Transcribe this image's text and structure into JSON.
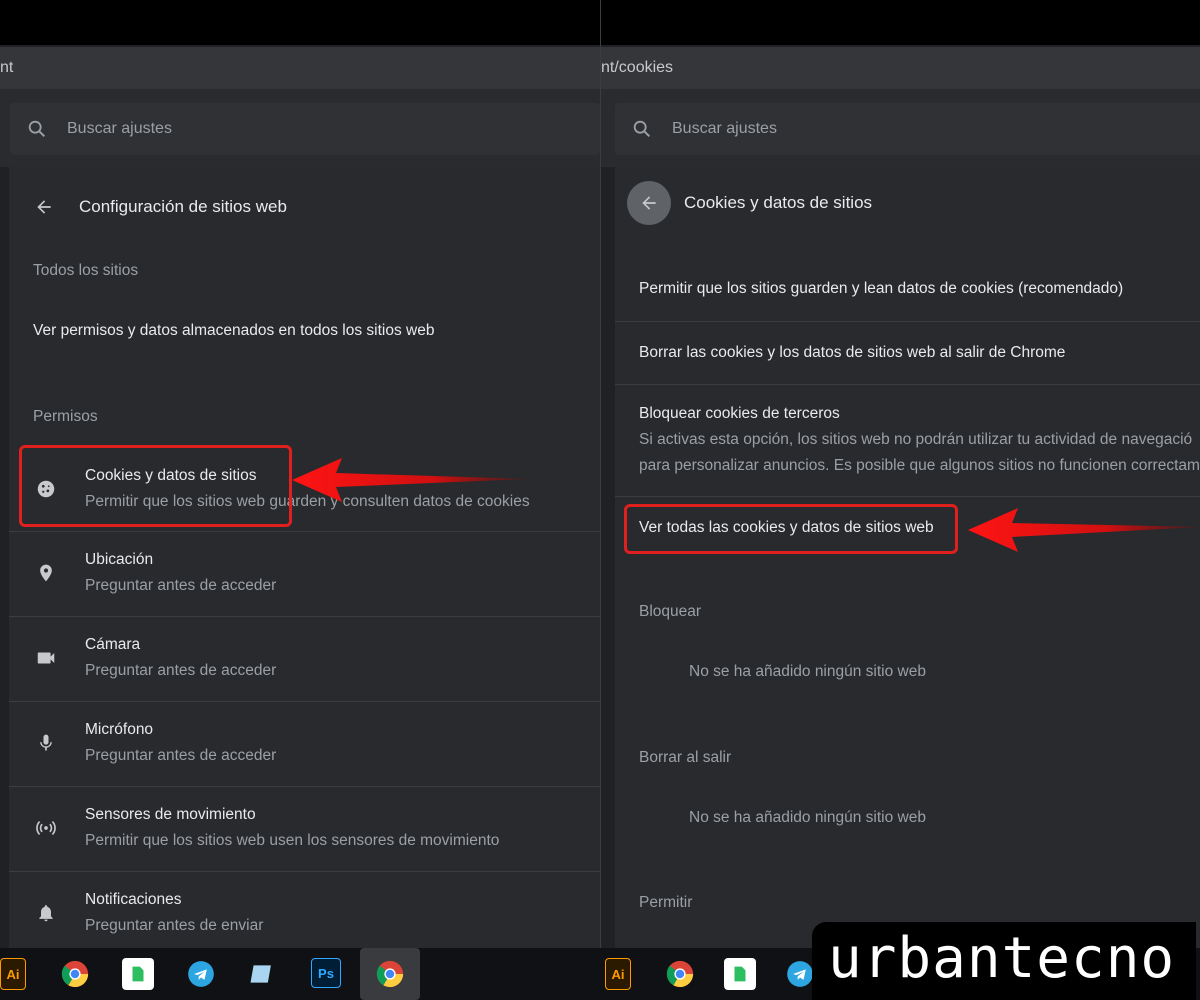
{
  "left": {
    "url": "nt",
    "search_placeholder": "Buscar ajustes",
    "header_title": "Configuración de sitios web",
    "all_sites": {
      "heading": "Todos los sitios",
      "link": "Ver permisos y datos almacenados en todos los sitios web"
    },
    "permissions_heading": "Permisos",
    "items": [
      {
        "title": "Cookies y datos de sitios",
        "subtitle": "Permitir que los sitios web guarden y consulten datos de cookies",
        "icon": "cookie-icon"
      },
      {
        "title": "Ubicación",
        "subtitle": "Preguntar antes de acceder",
        "icon": "location-pin-icon"
      },
      {
        "title": "Cámara",
        "subtitle": "Preguntar antes de acceder",
        "icon": "camera-icon"
      },
      {
        "title": "Micrófono",
        "subtitle": "Preguntar antes de acceder",
        "icon": "microphone-icon"
      },
      {
        "title": "Sensores de movimiento",
        "subtitle": "Permitir que los sitios web usen los sensores de movimiento",
        "icon": "motion-sensor-icon"
      },
      {
        "title": "Notificaciones",
        "subtitle": "Preguntar antes de enviar",
        "icon": "bell-icon"
      }
    ]
  },
  "right": {
    "url": "nt/cookies",
    "search_placeholder": "Buscar ajustes",
    "header_title": "Cookies y datos de sitios",
    "options": [
      {
        "label": "Permitir que los sitios guarden y lean datos de cookies (recomendado)"
      },
      {
        "label": "Borrar las cookies y los datos de sitios web al salir de Chrome"
      },
      {
        "label": "Bloquear cookies de terceros",
        "desc1": "Si activas esta opción, los sitios web no podrán utilizar tu actividad de navegació",
        "desc2": "para personalizar anuncios. Es posible que algunos sitios no funcionen correctam"
      }
    ],
    "view_all": "Ver todas las cookies y datos de sitios web",
    "block_heading": "Bloquear",
    "block_empty": "No se ha añadido ningún sitio web",
    "clear_heading": "Borrar al salir",
    "clear_empty": "No se ha añadido ningún sitio web",
    "allow_heading": "Permitir"
  },
  "taskbar": {
    "icons": [
      "illustrator-icon",
      "chrome-icon",
      "evernote-icon",
      "telegram-icon",
      "notepad-icon",
      "photoshop-icon",
      "chrome-active-icon"
    ],
    "illustrator_label": "Ai",
    "photoshop_label": "Ps"
  },
  "watermark": "urbantecno",
  "colors": {
    "background": "#202124",
    "card": "#292a2d",
    "text_primary": "#e8eaed",
    "text_secondary": "#9aa0a6",
    "highlight": "#e01f1f"
  }
}
